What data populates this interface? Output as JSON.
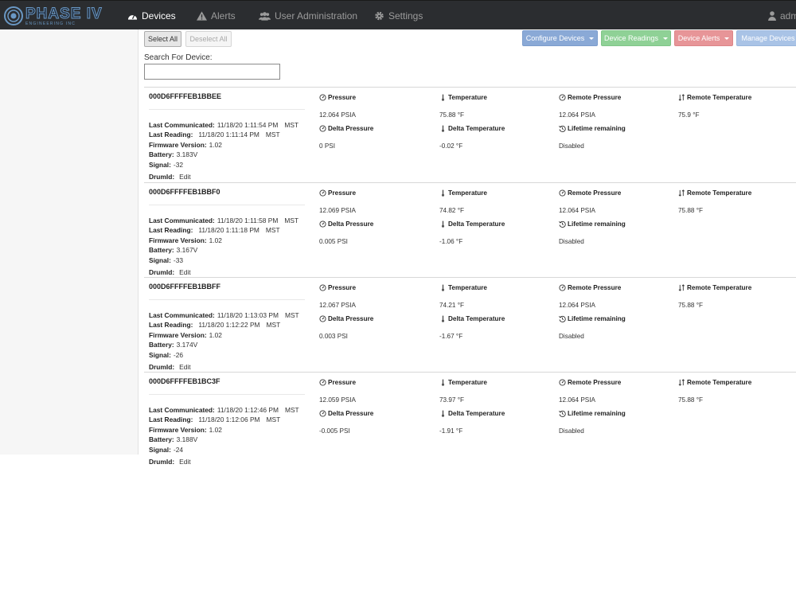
{
  "nav": {
    "brand": {
      "title": "PHASE IV",
      "subtitle": "ENGINEERING INC"
    },
    "items": [
      {
        "label": "Devices",
        "icon": "dashboard-icon",
        "active": true
      },
      {
        "label": "Alerts",
        "icon": "warning-icon",
        "active": false
      },
      {
        "label": "User Administration",
        "icon": "users-icon",
        "active": false
      },
      {
        "label": "Settings",
        "icon": "gear-icon",
        "active": false
      }
    ],
    "user": "adm"
  },
  "toolbar": {
    "select_all": "Select All",
    "deselect_all": "Deselect All",
    "configure": "Configure Devices",
    "readings": "Device Readings",
    "alerts": "Device Alerts",
    "manage": "Manage Devices"
  },
  "search": {
    "label": "Search For Device:",
    "value": "",
    "placeholder": ""
  },
  "labels": {
    "last_communicated": "Last Communicated:",
    "last_reading": "Last Reading:",
    "firmware": "Firmware Version:",
    "battery": "Battery:",
    "signal": "Signal:",
    "drum_id": "DrumId:",
    "edit": "Edit",
    "tz": "MST",
    "pressure": "Pressure",
    "temperature": "Temperature",
    "remote_pressure": "Remote Pressure",
    "remote_temperature": "Remote Temperature",
    "delta_pressure": "Delta Pressure",
    "delta_temperature": "Delta Temperature",
    "lifetime": "Lifetime remaining"
  },
  "devices": [
    {
      "id": "000D6FFFFEB1BBEE",
      "last_communicated": "11/18/20 1:11:54 PM",
      "last_reading": "11/18/20 1:11:14 PM",
      "firmware": "1.02",
      "battery": "3.183V",
      "signal": "-32",
      "pressure": "12.064 PSIA",
      "temperature": "75.88 °F",
      "remote_pressure": "12.064 PSIA",
      "remote_temperature": "75.9 °F",
      "delta_pressure": "0 PSI",
      "delta_temperature": "-0.02 °F",
      "lifetime": "Disabled"
    },
    {
      "id": "000D6FFFFEB1BBF0",
      "last_communicated": "11/18/20 1:11:58 PM",
      "last_reading": "11/18/20 1:11:18 PM",
      "firmware": "1.02",
      "battery": "3.167V",
      "signal": "-33",
      "pressure": "12.069 PSIA",
      "temperature": "74.82 °F",
      "remote_pressure": "12.064 PSIA",
      "remote_temperature": "75.88 °F",
      "delta_pressure": "0.005 PSI",
      "delta_temperature": "-1.06 °F",
      "lifetime": "Disabled"
    },
    {
      "id": "000D6FFFFEB1BBFF",
      "last_communicated": "11/18/20 1:13:03 PM",
      "last_reading": "11/18/20 1:12:22 PM",
      "firmware": "1.02",
      "battery": "3.174V",
      "signal": "-26",
      "pressure": "12.067 PSIA",
      "temperature": "74.21 °F",
      "remote_pressure": "12.064 PSIA",
      "remote_temperature": "75.88 °F",
      "delta_pressure": "0.003 PSI",
      "delta_temperature": "-1.67 °F",
      "lifetime": "Disabled"
    },
    {
      "id": "000D6FFFFEB1BC3F",
      "last_communicated": "11/18/20 1:12:46 PM",
      "last_reading": "11/18/20 1:12:06 PM",
      "firmware": "1.02",
      "battery": "3.188V",
      "signal": "-24",
      "pressure": "12.059 PSIA",
      "temperature": "73.97 °F",
      "remote_pressure": "12.064 PSIA",
      "remote_temperature": "75.88 °F",
      "delta_pressure": "-0.005 PSI",
      "delta_temperature": "-1.91 °F",
      "lifetime": "Disabled"
    }
  ]
}
